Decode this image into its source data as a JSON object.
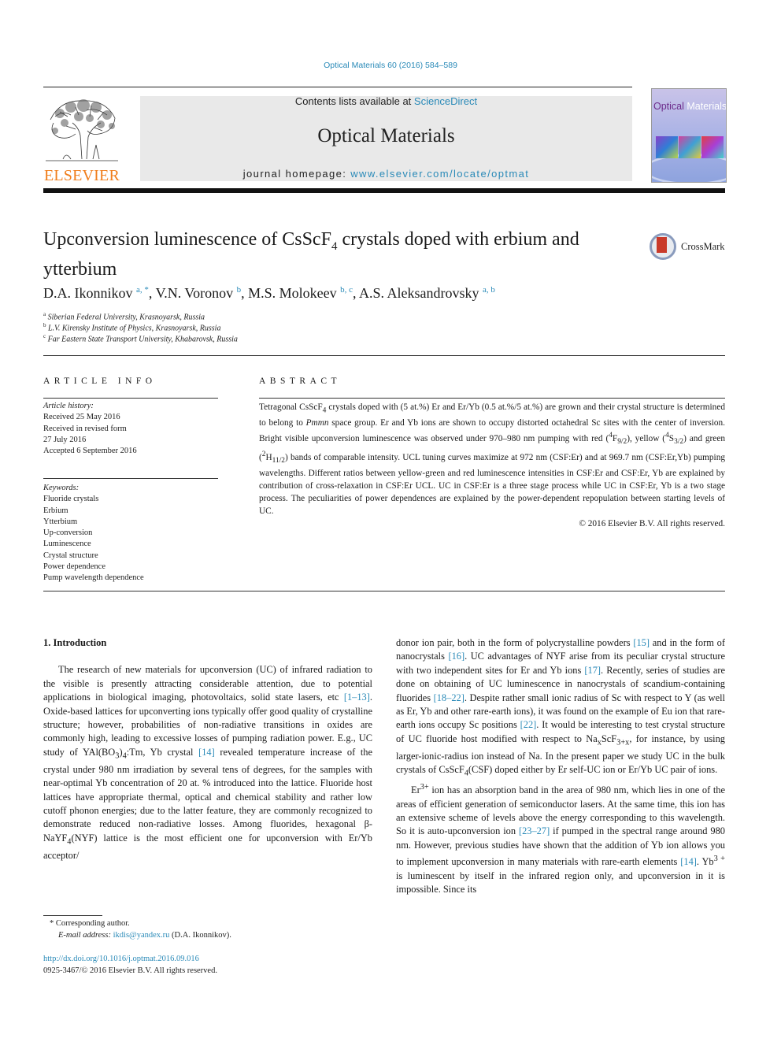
{
  "citation": "Optical Materials 60 (2016) 584–589",
  "header": {
    "publisher_logo": "ELSEVIER",
    "contents_prefix": "Contents lists available at ",
    "contents_link": "ScienceDirect",
    "journal_title": "Optical Materials",
    "homepage_prefix": "journal homepage: ",
    "homepage_link": "www.elsevier.com/locate/optmat",
    "cover": {
      "title_part1": "Optical",
      "title_part2": "Materials"
    }
  },
  "article": {
    "title_part1": "Upconversion luminescence of CsScF",
    "title_sub": "4",
    "title_part2": " crystals doped with erbium and ytterbium",
    "crossmark_label": "CrossMark",
    "authors": [
      {
        "name": "D.A. Ikonnikov",
        "sup": "a, *",
        "sep": ", "
      },
      {
        "name": "V.N. Voronov",
        "sup": "b",
        "sep": ", "
      },
      {
        "name": "M.S. Molokeev",
        "sup": "b, c",
        "sep": ", "
      },
      {
        "name": "A.S. Aleksandrovsky",
        "sup": "a, b",
        "sep": ""
      }
    ],
    "affiliations": [
      {
        "mark": "a",
        "text": "Siberian Federal University, Krasnoyarsk, Russia"
      },
      {
        "mark": "b",
        "text": "L.V. Kirensky Institute of Physics, Krasnoyarsk, Russia"
      },
      {
        "mark": "c",
        "text": "Far Eastern State Transport University, Khabarovsk, Russia"
      }
    ]
  },
  "article_info": {
    "heading": "ARTICLE INFO",
    "history_label": "Article history:",
    "history": [
      "Received 25 May 2016",
      "Received in revised form",
      "27 July 2016",
      "Accepted 6 September 2016"
    ],
    "keywords_label": "Keywords:",
    "keywords": [
      "Fluoride crystals",
      "Erbium",
      "Ytterbium",
      "Up-conversion",
      "Luminescence",
      "Crystal structure",
      "Power dependence",
      "Pump wavelength dependence"
    ]
  },
  "abstract": {
    "heading": "ABSTRACT",
    "p1": "Tetragonal CsScF",
    "p1_sub": "4",
    "p2": " crystals doped with (5 at.%) Er and Er/Yb (0.5 at.%/5 at.%) are grown and their crystal structure is determined to belong to ",
    "space_group": "Pmmn",
    "p3": " space group. Er and Yb ions are shown to occupy distorted octahedral Sc sites with the center of inversion. Bright visible upconversion luminescence was observed under 970–980 nm pumping with red (",
    "red_sup": "4",
    "red_base": "F",
    "red_sub": "9/2",
    "p4": "), yellow (",
    "yellow_sup": "4",
    "yellow_base": "S",
    "yellow_sub": "3/2",
    "p5": ") and green (",
    "green_sup": "2",
    "green_base": "H",
    "green_sub": "11/2",
    "p6": ") bands of comparable intensity. UCL tuning curves maximize at 972 nm (CSF:Er) and at 969.7 nm (CSF:Er,Yb) pumping wavelengths. Different ratios between yellow-green and red luminescence intensities in CSF:Er and CSF:Er, Yb are explained by contribution of cross-relaxation in CSF:Er UCL. UC in CSF:Er is a three stage process while UC in CSF:Er, Yb is a two stage process. The peculiarities of power dependences are explained by the power-dependent repopulation between starting levels of UC.",
    "copyright": "© 2016 Elsevier B.V. All rights reserved."
  },
  "intro": {
    "heading": "1.  Introduction",
    "left": {
      "a": "The research of new materials for upconversion (UC) of infrared radiation to the visible is presently attracting considerable attention, due to potential applications in biological imaging, photovoltaics, solid state lasers, etc ",
      "ref1": "[1–13]",
      "b": ". Oxide-based lattices for upconverting ions typically offer good quality of crystalline structure; however, probabilities of non-radiative transitions in oxides are commonly high, leading to excessive losses of pumping radiation power. E.g., UC study of YAl(BO",
      "b_sub1": "3",
      "b2": ")",
      "b_sub2": "4",
      "b3": ":Tm, Yb crystal ",
      "ref2": "[14]",
      "c": " revealed temperature increase of the crystal under 980 nm irradiation by several tens of degrees, for the samples with near-optimal Yb concentration of 20 at. % introduced into the lattice. Fluoride host lattices have appropriate thermal, optical and chemical stability and rather low cutoff phonon energies; due to the latter feature, they are commonly recognized to demonstrate reduced non-radiative losses. Among fluorides, hexagonal β-NaYF",
      "c_sub": "4",
      "d": "(NYF) lattice is the most efficient one for upconversion with Er/Yb acceptor/"
    },
    "right": {
      "a": "donor ion pair, both in the form of polycrystalline powders ",
      "ref15": "[15]",
      "b": " and in the form of nanocrystals ",
      "ref16": "[16]",
      "c": ". UC advantages of NYF arise from its peculiar crystal structure with two independent sites for Er and Yb ions ",
      "ref17": "[17]",
      "d": ". Recently, series of studies are done on obtaining of UC luminescence in nanocrystals of scandium-containing fluorides ",
      "ref18": "[18–22]",
      "e": ". Despite rather small ionic radius of Sc with respect to Y (as well as Er, Yb and other rare-earth ions), it was found on the example of Eu ion that rare-earth ions occupy Sc positions ",
      "ref22": "[22]",
      "f": ". It would be interesting to test crystal structure of UC fluoride host modified with respect to Na",
      "f_sub1": "x",
      "f2": "ScF",
      "f_sub2": "3+x",
      "g": ", for instance, by using larger-ionic-radius ion instead of Na. In the present paper we study UC in the bulk crystals of CsScF",
      "g_sub": "4",
      "h": "(CSF) doped either by Er self-UC ion or Er/Yb UC pair of ions.",
      "p2_a": "Er",
      "p2_sup": "3+",
      "p2_b": " ion has an absorption band in the area of 980 nm, which lies in one of the areas of efficient generation of semiconductor lasers. At the same time, this ion has an extensive scheme of levels above the energy corresponding to this wavelength. So it is auto-upconversion ion ",
      "ref23": "[23–27]",
      "p2_c": " if pumped in the spectral range around 980 nm. However, previous studies have shown that the addition of Yb ion allows you to implement upconversion in many materials with rare-earth elements ",
      "ref14": "[14]",
      "p2_d": ". Yb",
      "p2_sup2": "3 +",
      "p2_e": " is luminescent by itself in the infrared region only, and upconversion in it is impossible. Since its"
    }
  },
  "footnotes": {
    "corresponding": "* Corresponding author.",
    "email_label": "E-mail address: ",
    "email": "ikdis@yandex.ru",
    "email_suffix": " (D.A. Ikonnikov).",
    "doi": "http://dx.doi.org/10.1016/j.optmat.2016.09.016",
    "issn": "0925-3467/© 2016 Elsevier B.V. All rights reserved."
  },
  "colors": {
    "link": "#2a8ab8",
    "elsevier_orange": "#f07d1a",
    "band_grey": "#e9e9e9"
  }
}
